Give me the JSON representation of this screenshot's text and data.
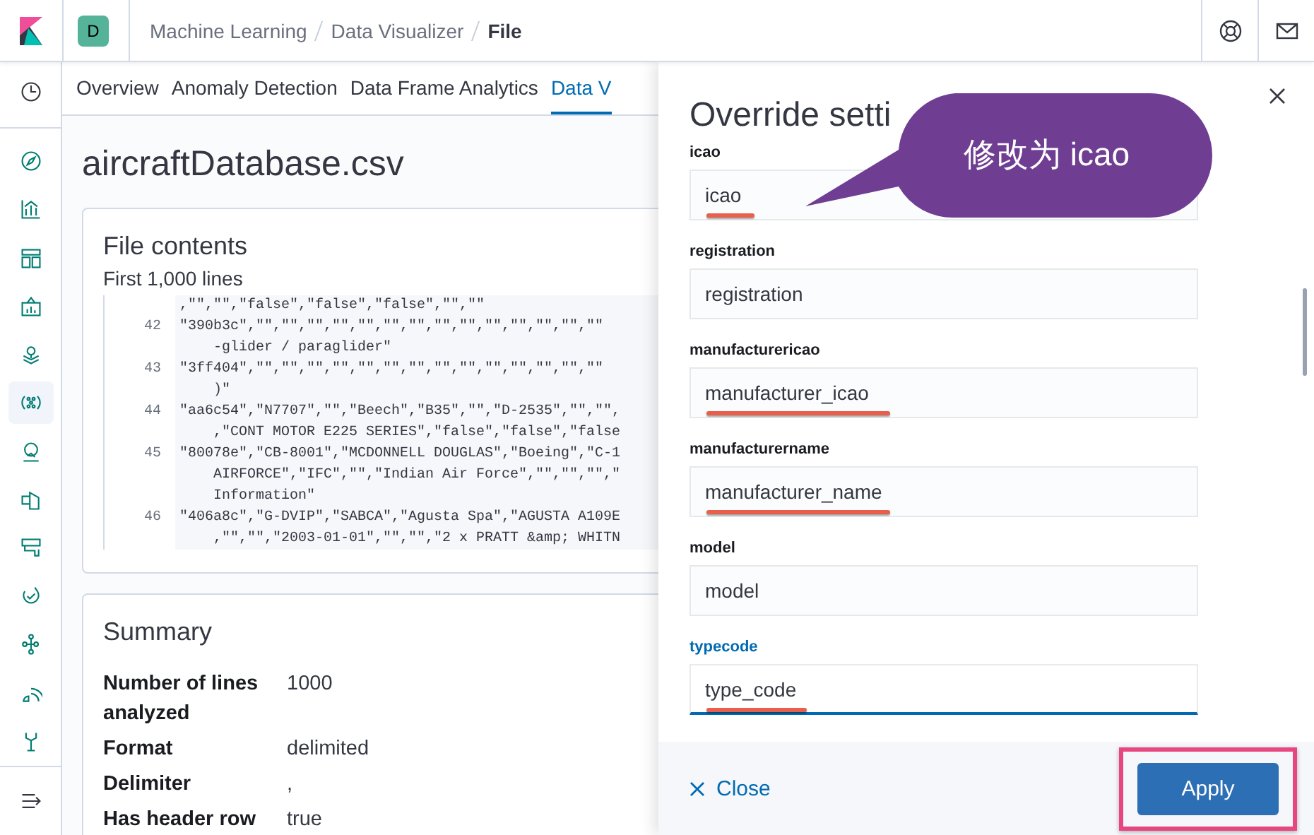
{
  "header": {
    "avatar": "D",
    "breadcrumbs": [
      {
        "label": "Machine Learning",
        "current": false
      },
      {
        "label": "Data Visualizer",
        "current": false
      },
      {
        "label": "File",
        "current": true
      }
    ]
  },
  "nav": {
    "items": [
      {
        "selected": false
      },
      {
        "selected": false
      },
      {
        "selected": false
      },
      {
        "selected": false
      },
      {
        "selected": false
      },
      {
        "selected": false
      },
      {
        "selected": true
      },
      {
        "selected": false
      },
      {
        "selected": false
      },
      {
        "selected": false
      },
      {
        "selected": false
      },
      {
        "selected": false
      },
      {
        "selected": false
      },
      {
        "selected": false
      }
    ]
  },
  "tabs": [
    {
      "label": "Overview",
      "selected": false
    },
    {
      "label": "Anomaly Detection",
      "selected": false
    },
    {
      "label": "Data Frame Analytics",
      "selected": false
    },
    {
      "label": "Data V",
      "selected": true
    }
  ],
  "page_title": "aircraftDatabase.csv",
  "file_contents": {
    "title": "File contents",
    "subtitle": "First 1,000 lines",
    "lines": [
      {
        "rows": [
          ",\"\",\"\",\"false\",\"false\",\"false\",\"\",\"\""
        ]
      },
      {
        "number": "42",
        "rows": [
          "\"390b3c\",\"\",\"\",\"\",\"\",\"\",\"\",\"\",\"\",\"\",\"\",\"\",\"\",\"\",\"\"",
          "-glider / paraglider\""
        ]
      },
      {
        "number": "43",
        "rows": [
          "\"3ff404\",\"\",\"\",\"\",\"\",\"\",\"\",\"\",\"\",\"\",\"\",\"\",\"\",\"\",\"\"",
          ")\""
        ]
      },
      {
        "number": "44",
        "rows": [
          "\"aa6c54\",\"N7707\",\"\",\"Beech\",\"B35\",\"\",\"D-2535\",\"\",\"\",",
          ",\"CONT MOTOR E225 SERIES\",\"false\",\"false\",\"false"
        ]
      },
      {
        "number": "45",
        "rows": [
          "\"80078e\",\"CB-8001\",\"MCDONNELL DOUGLAS\",\"Boeing\",\"C-1",
          "AIRFORCE\",\"IFC\",\"\",\"Indian Air Force\",\"\",\"\",\"\",\"",
          "Information\""
        ]
      },
      {
        "number": "46",
        "rows": [
          "\"406a8c\",\"G-DVIP\",\"SABCA\",\"Agusta Spa\",\"AGUSTA A109E",
          ",\"\",\"\",\"2003-01-01\",\"\",\"\",\"2 x PRATT &amp; WHITN"
        ]
      }
    ]
  },
  "summary": {
    "title": "Summary",
    "rows": [
      {
        "label": "Number of lines analyzed",
        "value": "1000"
      },
      {
        "label": "Format",
        "value": "delimited"
      },
      {
        "label": "Delimiter",
        "value": ","
      },
      {
        "label": "Has header row",
        "value": "true"
      }
    ]
  },
  "flyout": {
    "title": "Override setti",
    "fields": [
      {
        "label": "icao",
        "value": "icao",
        "focused": false,
        "underlined": true
      },
      {
        "label": "registration",
        "value": "registration",
        "focused": false,
        "underlined": false
      },
      {
        "label": "manufacturericao",
        "value": "manufacturer_icao",
        "focused": false,
        "underlined": true
      },
      {
        "label": "manufacturername",
        "value": "manufacturer_name",
        "focused": false,
        "underlined": true
      },
      {
        "label": "model",
        "value": "model",
        "focused": false,
        "underlined": false
      },
      {
        "label": "typecode",
        "value": "type_code",
        "focused": true,
        "underlined": true
      }
    ],
    "close_label": "Close",
    "apply": {
      "label": "Apply",
      "highlighted": true
    }
  },
  "callout": {
    "text": "修改为 icao"
  }
}
